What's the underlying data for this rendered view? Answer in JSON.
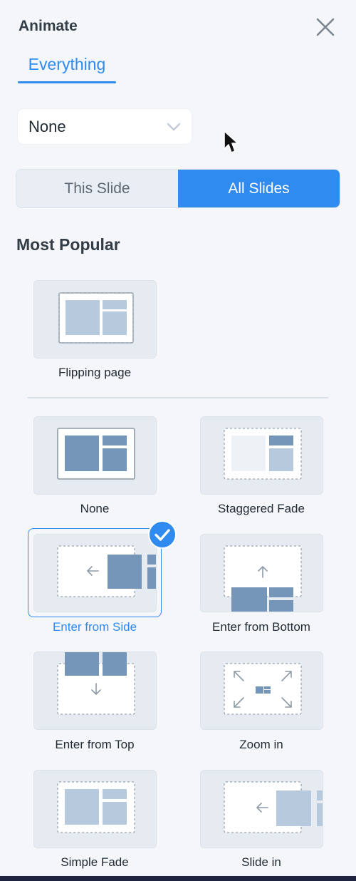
{
  "panel": {
    "title": "Animate",
    "tab_label": "Everything",
    "dropdown_value": "None",
    "scope": {
      "this_slide": "This Slide",
      "all_slides": "All Slides",
      "selected": "All Slides"
    },
    "section_title": "Most Popular"
  },
  "animations": {
    "featured": {
      "label": "Flipping page"
    },
    "items": [
      {
        "label": "None"
      },
      {
        "label": "Staggered Fade"
      },
      {
        "label": "Enter from Side",
        "selected": true
      },
      {
        "label": "Enter from Bottom"
      },
      {
        "label": "Enter from Top"
      },
      {
        "label": "Zoom in"
      },
      {
        "label": "Simple Fade"
      },
      {
        "label": "Slide in"
      }
    ]
  },
  "colors": {
    "accent": "#2f8bf0",
    "tile_dark": "#7596b9",
    "tile_light": "#b7c9dc",
    "tile_bg": "#e6ebf1"
  },
  "icons": [
    "close-icon",
    "chevron-down-icon",
    "mouse-cursor-icon",
    "checkmark-icon"
  ]
}
